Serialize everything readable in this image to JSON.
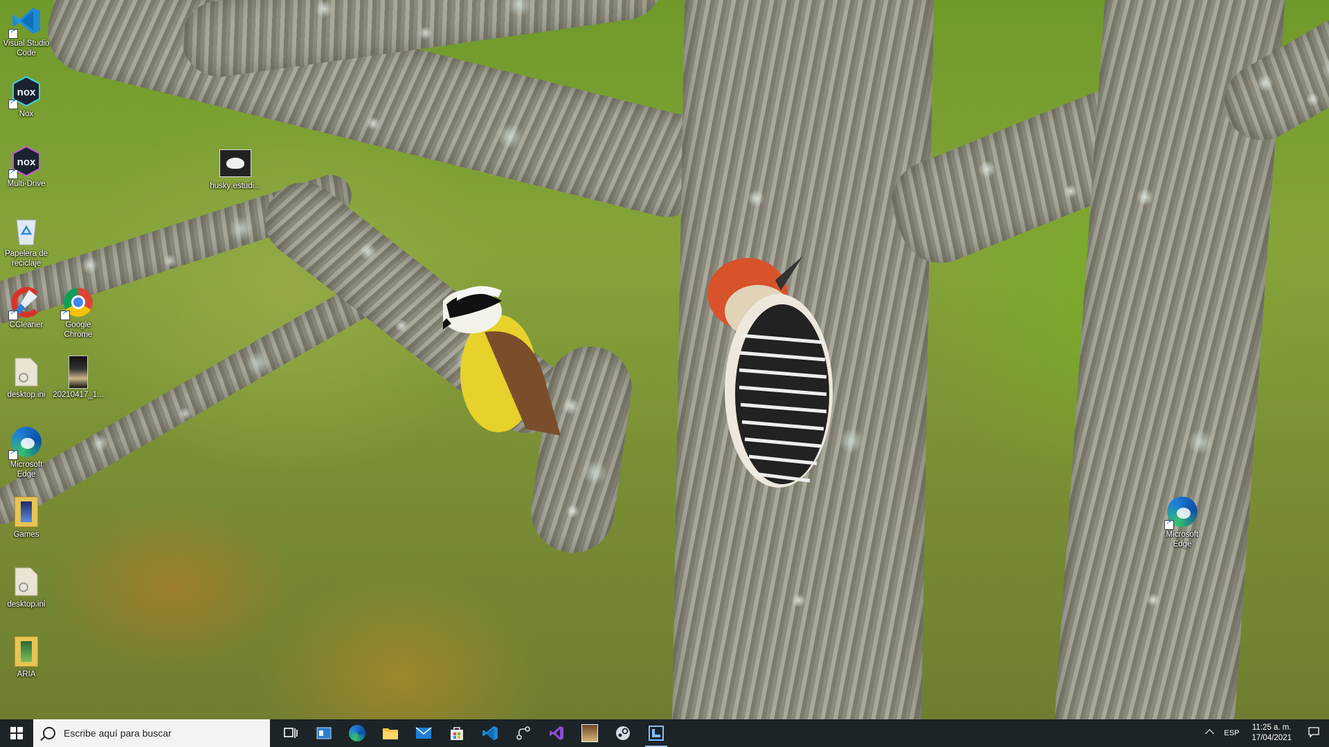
{
  "desktop": {
    "icons": [
      {
        "label": "Visual Studio Code",
        "icon": "vscode-icon"
      },
      {
        "label": "Nox",
        "icon": "nox-icon"
      },
      {
        "label": "Multi-Drive",
        "icon": "nox-multidrive-icon"
      },
      {
        "label": "husky estudi...",
        "icon": "image-file-icon"
      },
      {
        "label": "Papelera de reciclaje",
        "icon": "recycle-bin-icon"
      },
      {
        "label": "CCleaner",
        "icon": "ccleaner-icon"
      },
      {
        "label": "Google Chrome",
        "icon": "chrome-icon"
      },
      {
        "label": "desktop.ini",
        "icon": "ini-file-icon"
      },
      {
        "label": "20210417_1...",
        "icon": "photo-file-icon"
      },
      {
        "label": "Microsoft Edge",
        "icon": "edge-icon"
      },
      {
        "label": "Games",
        "icon": "folder-icon"
      },
      {
        "label": "desktop.ini",
        "icon": "ini-file-icon"
      },
      {
        "label": "ARIA",
        "icon": "folder-icon"
      },
      {
        "label": "Microsoft Edge",
        "icon": "edge-icon"
      }
    ]
  },
  "taskbar": {
    "search_placeholder": "Escribe aquí para buscar",
    "pinned": [
      "task-view-icon",
      "explorer-window-icon",
      "edge-icon",
      "file-explorer-icon",
      "mail-icon",
      "store-icon",
      "vscode-icon",
      "git-icon",
      "visual-studio-icon",
      "photo-app-icon",
      "steam-icon",
      "app-l-icon"
    ],
    "tray": {
      "language": "ESP",
      "time": "11:25 a. m.",
      "date": "17/04/2021"
    }
  },
  "colors": {
    "taskbar_bg": "#1d2428",
    "search_bg": "#f3f3f3",
    "vscode_blue": "#1f8ad2",
    "edge_blue": "#1f7fd6",
    "edge_green": "#35c06b"
  }
}
